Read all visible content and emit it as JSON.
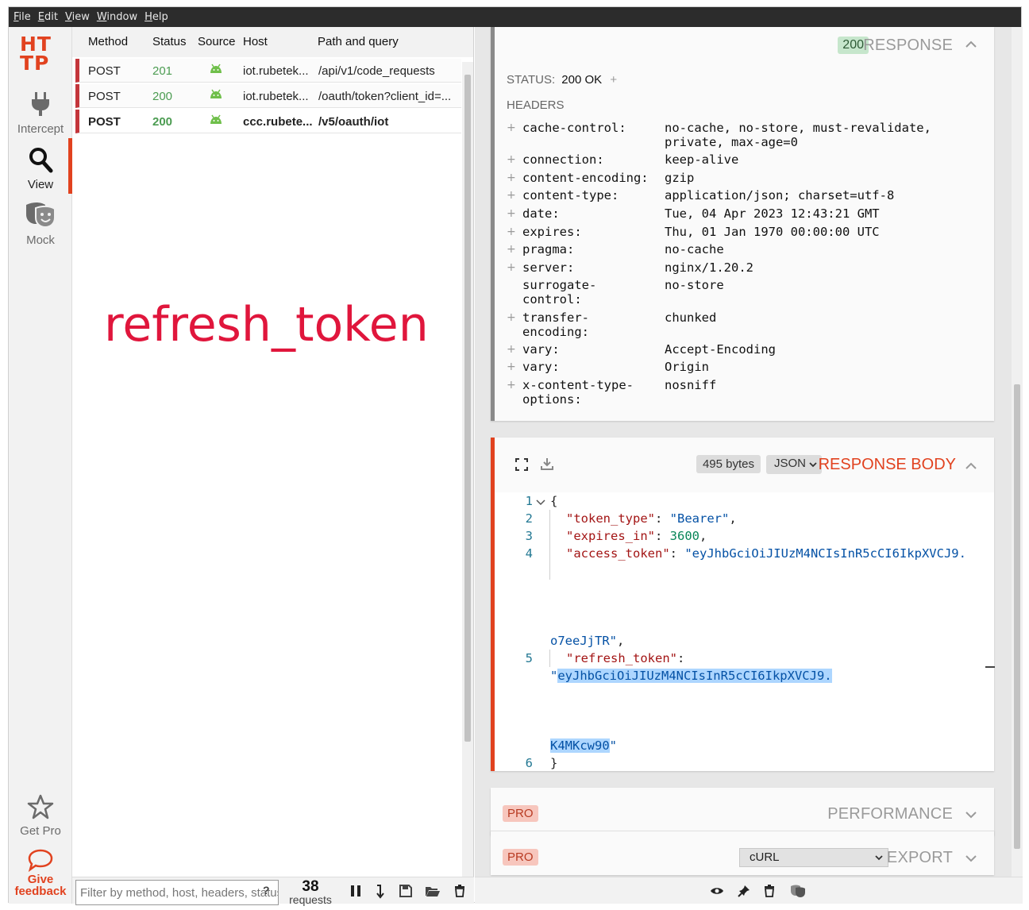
{
  "menu": [
    "File",
    "Edit",
    "View",
    "Window",
    "Help"
  ],
  "nav": {
    "logo_line1": "HT",
    "logo_line2": "TP",
    "intercept": "Intercept",
    "view": "View",
    "mock": "Mock",
    "get_pro": "Get Pro",
    "give_feedback_1": "Give",
    "give_feedback_2": "feedback"
  },
  "list": {
    "headers": {
      "method": "Method",
      "status": "Status",
      "source": "Source",
      "host": "Host",
      "path": "Path and query"
    },
    "rows": [
      {
        "method": "POST",
        "status": "201",
        "host": "iot.rubetek...",
        "path": "/api/v1/code_requests"
      },
      {
        "method": "POST",
        "status": "200",
        "host": "iot.rubetek...",
        "path": "/oauth/token?client_id=..."
      },
      {
        "method": "POST",
        "status": "200",
        "host": "ccc.rubete...",
        "path": "/v5/oauth/iot"
      }
    ],
    "caption": "refresh_token",
    "filter_placeholder": "Filter by method, host, headers, status...",
    "filter_help": "?",
    "request_count": "38",
    "request_label": "requests"
  },
  "response": {
    "status_badge": "200",
    "title": "RESPONSE",
    "status_label": "STATUS:",
    "status_value": "200 OK",
    "headers_label": "HEADERS",
    "headers": [
      {
        "key": "cache-control:",
        "value": "no-cache, no-store, must-revalidate,",
        "value2": "private, max-age=0",
        "expandable": "+"
      },
      {
        "key": "connection:",
        "value": "keep-alive",
        "expandable": "+"
      },
      {
        "key": "content-encoding:",
        "value": "gzip",
        "expandable": "+"
      },
      {
        "key": "content-type:",
        "value": "application/json; charset=utf-8",
        "expandable": "+"
      },
      {
        "key": "date:",
        "value": "Tue, 04 Apr 2023 12:43:21 GMT",
        "expandable": "+"
      },
      {
        "key": "expires:",
        "value": "Thu, 01 Jan 1970 00:00:00 UTC",
        "expandable": "+"
      },
      {
        "key": "pragma:",
        "value": "no-cache",
        "expandable": "+"
      },
      {
        "key": "server:",
        "value": "nginx/1.20.2",
        "expandable": "+"
      },
      {
        "key": "surrogate-",
        "key2": "control:",
        "value": "no-store",
        "expandable": ""
      },
      {
        "key": "transfer-",
        "key2": "encoding:",
        "value": "chunked",
        "expandable": "+"
      },
      {
        "key": "vary:",
        "value": "Accept-Encoding",
        "expandable": "+"
      },
      {
        "key": "vary:",
        "value": "Origin",
        "expandable": "+"
      },
      {
        "key": "x-content-type-",
        "key2": "options:",
        "value": "nosniff",
        "expandable": "+"
      }
    ]
  },
  "body": {
    "bytes": "495 bytes",
    "format": "JSON",
    "title": "RESPONSE BODY",
    "lines": {
      "l1": "1",
      "l2": "2",
      "l3": "3",
      "l4": "4",
      "l5": "5",
      "l6": "6",
      "open_brace": "{",
      "token_type_key": "\"token_type\"",
      "token_type_val": "\"Bearer\"",
      "expires_key": "\"expires_in\"",
      "expires_val": "3600",
      "access_key": "\"access_token\"",
      "access_val": "\"eyJhbGciOiJIUzM4NCIsInR5cCI6IkpXVCJ9.",
      "access_end": "o7eeJjTR\"",
      "refresh_key": "\"refresh_token\"",
      "refresh_quote": "\"",
      "refresh_val": "eyJhbGciOiJIUzM4NCIsInR5cCI6IkpXVCJ9.",
      "refresh_end": "K4MKcw90",
      "close_quote": "\"",
      "close_brace": "}"
    }
  },
  "performance": {
    "pro": "PRO",
    "title": "PERFORMANCE"
  },
  "export": {
    "pro": "PRO",
    "format": "cURL",
    "title": "EXPORT"
  },
  "colors": {
    "accent": "#e1421f",
    "status_ok": "#4c9c52",
    "caption": "#e0163c"
  }
}
